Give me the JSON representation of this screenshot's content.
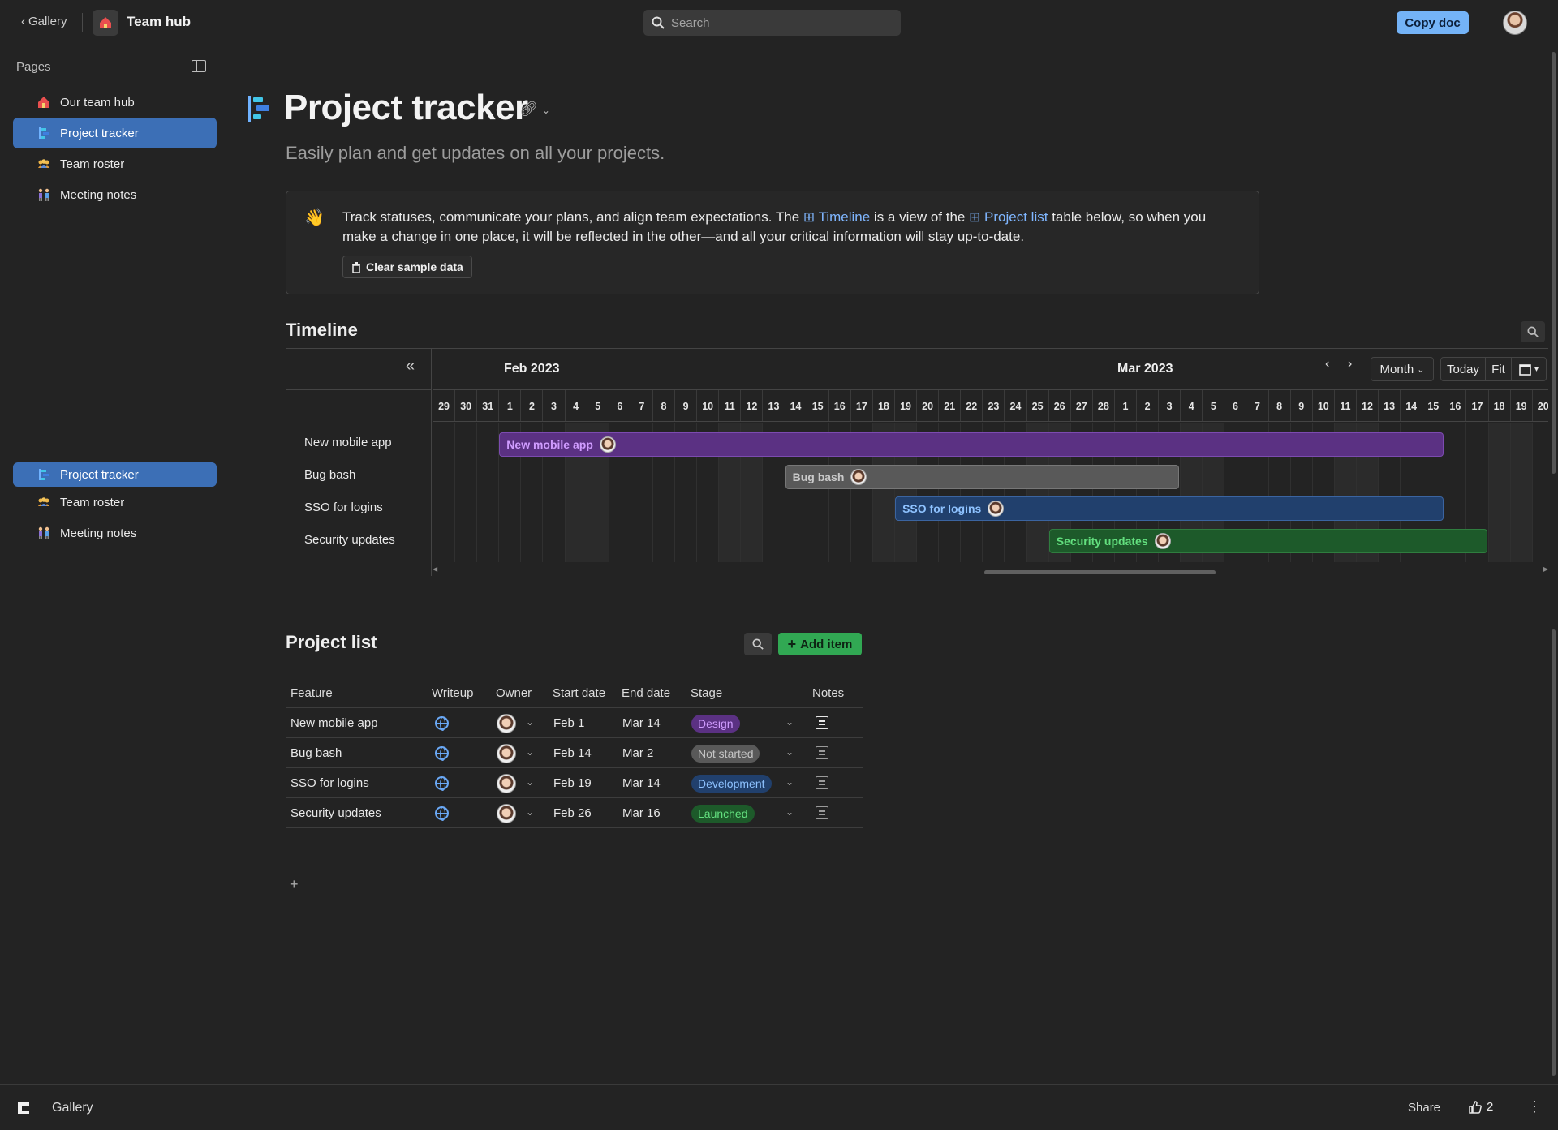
{
  "topbar": {
    "back_label": "Gallery",
    "app_title": "Team hub",
    "search_placeholder": "Search",
    "copy_doc_label": "Copy doc"
  },
  "sidebar": {
    "heading": "Pages",
    "items": [
      {
        "label": "Our team hub",
        "icon": "house-icon"
      },
      {
        "label": "Project tracker",
        "icon": "timeline-icon",
        "active": true
      },
      {
        "label": "Team roster",
        "icon": "people-icon"
      },
      {
        "label": "Meeting notes",
        "icon": "meeting-icon"
      }
    ],
    "items_repeat": [
      {
        "label": "Project tracker",
        "icon": "timeline-icon",
        "active": true
      },
      {
        "label": "Team roster",
        "icon": "people-icon"
      },
      {
        "label": "Meeting notes",
        "icon": "meeting-icon"
      }
    ]
  },
  "page": {
    "title": "Project tracker",
    "subtitle": "Easily plan and get updates on all your projects.",
    "callout": {
      "emoji": "👋",
      "text_1": "Track statuses, communicate your plans, and align team expectations. The ",
      "link_1": "Timeline",
      "text_2": " is a view of the ",
      "link_2": "Project list",
      "text_3": " table below, so when you make a change in one place, it will be reflected in the other—and all your critical information will stay up-to-date.",
      "clear_button": "Clear sample data"
    }
  },
  "timeline": {
    "title": "Timeline",
    "month_1": "Feb 2023",
    "month_2": "Mar 2023",
    "view_select": "Month",
    "today_label": "Today",
    "fit_label": "Fit",
    "days": [
      "29",
      "30",
      "31",
      "1",
      "2",
      "3",
      "4",
      "5",
      "6",
      "7",
      "8",
      "9",
      "10",
      "11",
      "12",
      "13",
      "14",
      "15",
      "16",
      "17",
      "18",
      "19",
      "20",
      "21",
      "22",
      "23",
      "24",
      "25",
      "26",
      "27",
      "28",
      "1",
      "2",
      "3",
      "4",
      "5",
      "6",
      "7",
      "8",
      "9",
      "10",
      "11",
      "12",
      "13",
      "14",
      "15",
      "16",
      "17",
      "18",
      "19",
      "20"
    ],
    "rows": [
      "New mobile app",
      "Bug bash",
      "SSO for logins",
      "Security updates"
    ],
    "bars": [
      {
        "label": "New mobile app",
        "start_index": 3,
        "end_index": 45,
        "bg": "#5b3183",
        "fg": "#d09cff",
        "border": "#7c4bb0"
      },
      {
        "label": "Bug bash",
        "start_index": 16,
        "end_index": 33,
        "bg": "#595959",
        "fg": "#c9c9c9",
        "border": "#777777"
      },
      {
        "label": "SSO for logins",
        "start_index": 21,
        "end_index": 45,
        "bg": "#21406d",
        "fg": "#8ec2ff",
        "border": "#3b64a0"
      },
      {
        "label": "Security updates",
        "start_index": 28,
        "end_index": 47,
        "bg": "#1d5a2a",
        "fg": "#63e07f",
        "border": "#2f7d3f"
      }
    ]
  },
  "project_list": {
    "title": "Project list",
    "add_item_label": "Add item",
    "columns": [
      "Feature",
      "Writeup",
      "Owner",
      "Start date",
      "End date",
      "Stage",
      "Notes"
    ],
    "rows": [
      {
        "feature": "New mobile app",
        "start": "Feb 1",
        "end": "Mar 14",
        "stage": "Design",
        "stage_bg": "#5b3183",
        "stage_fg": "#d09cff"
      },
      {
        "feature": "Bug bash",
        "start": "Feb 14",
        "end": "Mar 2",
        "stage": "Not started",
        "stage_bg": "#595959",
        "stage_fg": "#c4c4c4"
      },
      {
        "feature": "SSO for logins",
        "start": "Feb 19",
        "end": "Mar 14",
        "stage": "Development",
        "stage_bg": "#21406d",
        "stage_fg": "#8ec2ff"
      },
      {
        "feature": "Security updates",
        "start": "Feb 26",
        "end": "Mar 16",
        "stage": "Launched",
        "stage_bg": "#1d5a2a",
        "stage_fg": "#63e07f"
      }
    ]
  },
  "footer": {
    "gallery_label": "Gallery",
    "share_label": "Share",
    "like_count": "2"
  }
}
